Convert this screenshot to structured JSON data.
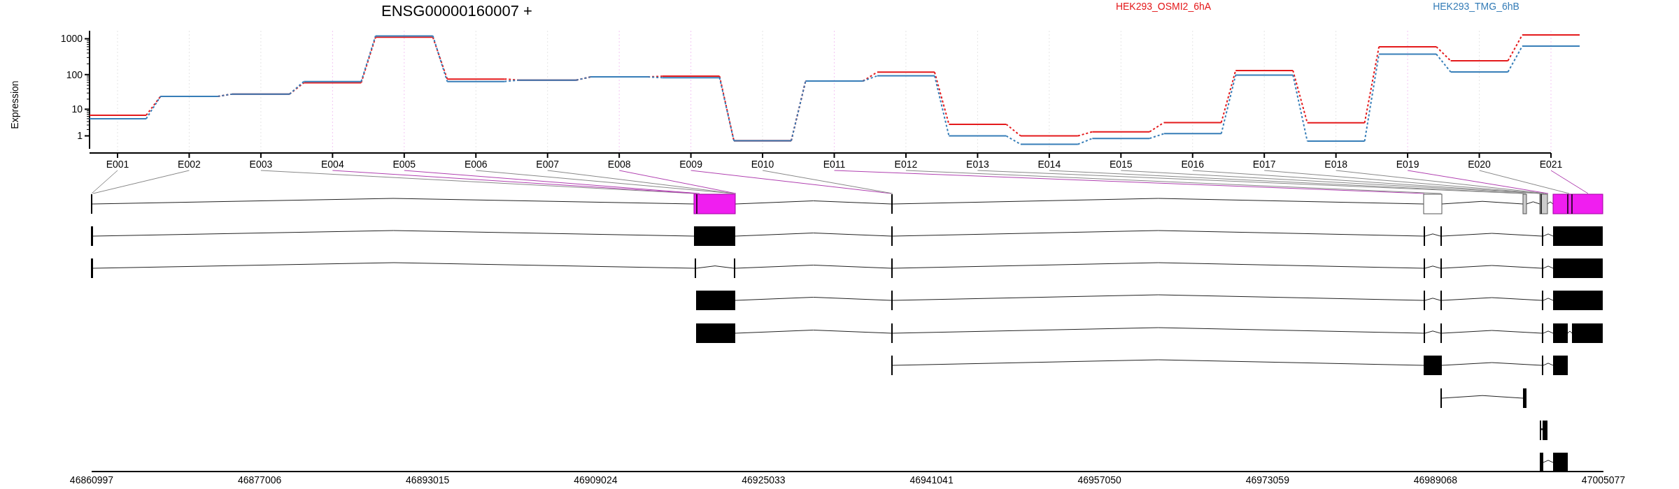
{
  "title": "ENSG00000160007 +",
  "legend": [
    {
      "label": "HEK293_OSMI2_6hA",
      "color": "#e41a1c"
    },
    {
      "label": "HEK293_TMG_6hB",
      "color": "#377eb8"
    }
  ],
  "ylabel": "Expression",
  "ytick_labels": [
    "1000",
    "100",
    "10",
    "1"
  ],
  "exon_labels": [
    "E001",
    "E002",
    "E003",
    "E004",
    "E005",
    "E006",
    "E007",
    "E008",
    "E009",
    "E010",
    "E011",
    "E012",
    "E013",
    "E014",
    "E015",
    "E016",
    "E017",
    "E018",
    "E019",
    "E020",
    "E021"
  ],
  "genomic_axis_labels": [
    "46860997",
    "46877006",
    "46893015",
    "46909024",
    "46925033",
    "46941041",
    "46957050",
    "46973059",
    "46989068",
    "47005077"
  ]
}
